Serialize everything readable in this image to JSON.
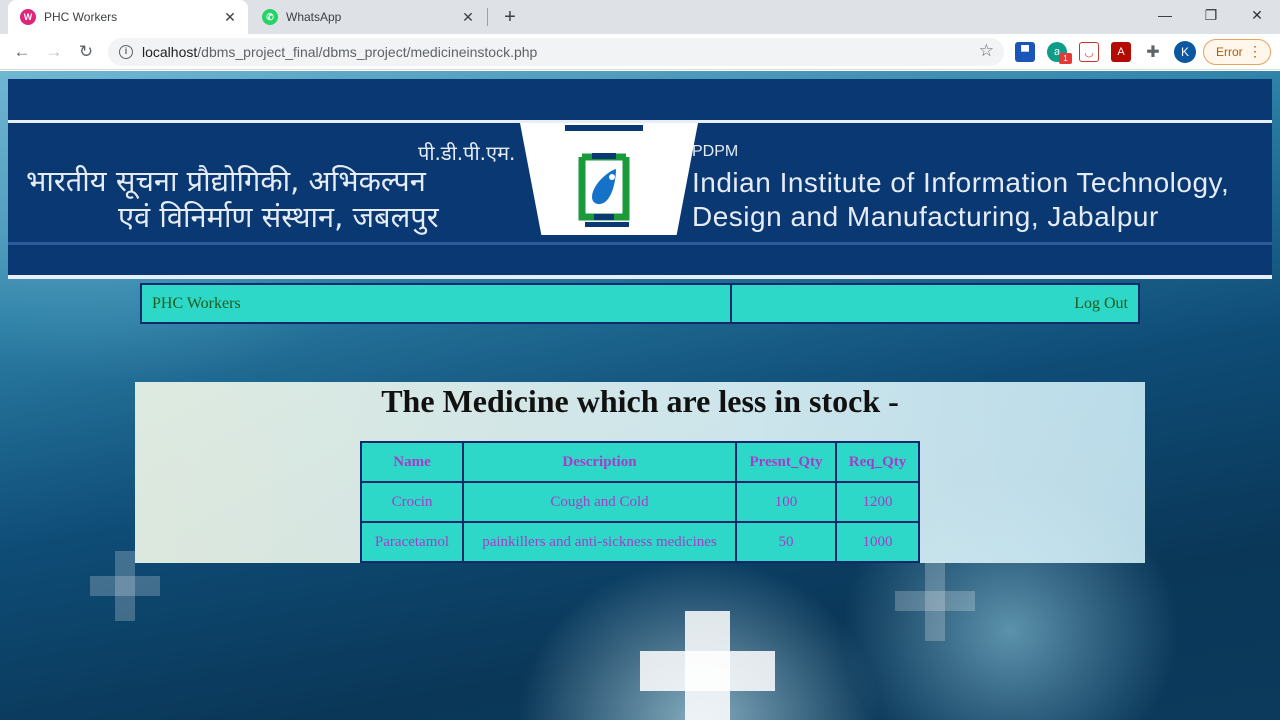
{
  "browser": {
    "tabs": [
      {
        "title": "PHC Workers",
        "active": true
      },
      {
        "title": "WhatsApp",
        "active": false
      }
    ],
    "url_host": "localhost",
    "url_path": "/dbms_project_final/dbms_project/medicineinstock.php",
    "profile_initial": "K",
    "error_label": "Error",
    "extension_badge": "1"
  },
  "banner": {
    "hindi_line1": "पी.डी.पी.एम.",
    "hindi_line2": "भारतीय सूचना प्रौद्योगिकी, अभिकल्पन",
    "hindi_line3": "एवं विनिर्माण संस्थान, जबलपुर",
    "en_abbr": "PDPM",
    "en_line1": "Indian Institute of Information Technology,",
    "en_line2": "Design and Manufacturing, Jabalpur"
  },
  "nav": {
    "left_label": "PHC Workers",
    "right_label": "Log Out"
  },
  "main": {
    "heading": "The Medicine which are less in stock -",
    "table": {
      "columns": [
        "Name",
        "Description",
        "Presnt_Qty",
        "Req_Qty"
      ],
      "rows": [
        [
          "Crocin",
          "Cough and Cold",
          "100",
          "1200"
        ],
        [
          "Paracetamol",
          "painkillers and anti-sickness medicines",
          "50",
          "1000"
        ]
      ]
    }
  },
  "colors": {
    "banner_bg": "#0a3872",
    "nav_bg": "#2ed8c8",
    "table_text": "#a23ec8",
    "border": "#0f2a6b"
  }
}
